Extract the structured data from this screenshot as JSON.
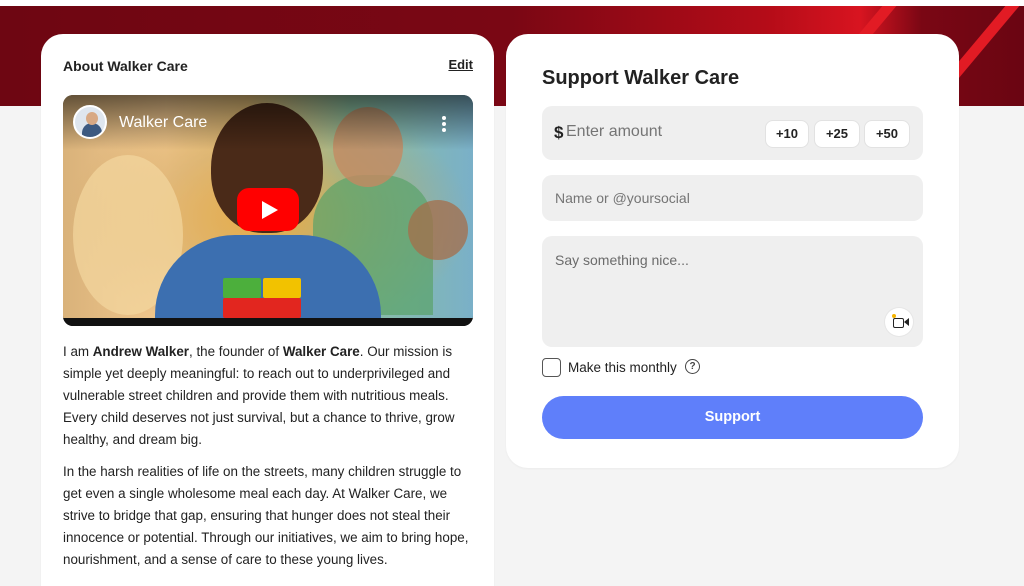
{
  "about": {
    "title": "About Walker Care",
    "edit_label": "Edit",
    "video": {
      "title": "Walker Care",
      "channel_avatar": "founder-photo",
      "play_icon": "play-icon",
      "menu_icon": "kebab-menu-icon"
    },
    "paragraphs": [
      {
        "pre": "I am ",
        "bold1": "Andrew Walker",
        "mid": ", the founder of ",
        "bold2": "Walker Care",
        "post": ". Our mission is simple yet deeply meaningful: to reach out to underprivileged and vulnerable street children and provide them with nutritious meals. Every child deserves not just survival, but a chance to thrive, grow healthy, and dream big."
      },
      {
        "text": "In the harsh realities of life on the streets, many children struggle to get even a single wholesome meal each day. At Walker Care, we strive to bridge that gap, ensuring that hunger does not steal their innocence or potential. Through our initiatives, we aim to bring hope, nourishment, and a sense of care to these young lives."
      }
    ]
  },
  "support": {
    "title": "Support Walker Care",
    "currency_symbol": "$",
    "amount_placeholder": "Enter amount",
    "quick_amounts": [
      "+10",
      "+25",
      "+50"
    ],
    "name_placeholder": "Name or @yoursocial",
    "message_placeholder": "Say something nice...",
    "video_message_icon": "video-camera-icon",
    "monthly_label": "Make this monthly",
    "monthly_checked": false,
    "help_icon": "question-circle-icon",
    "help_glyph": "?",
    "button_label": "Support",
    "button_color": "#5f7ffa"
  },
  "theme": {
    "banner_color": "#7a0714",
    "banner_accent": "#e21b24"
  }
}
